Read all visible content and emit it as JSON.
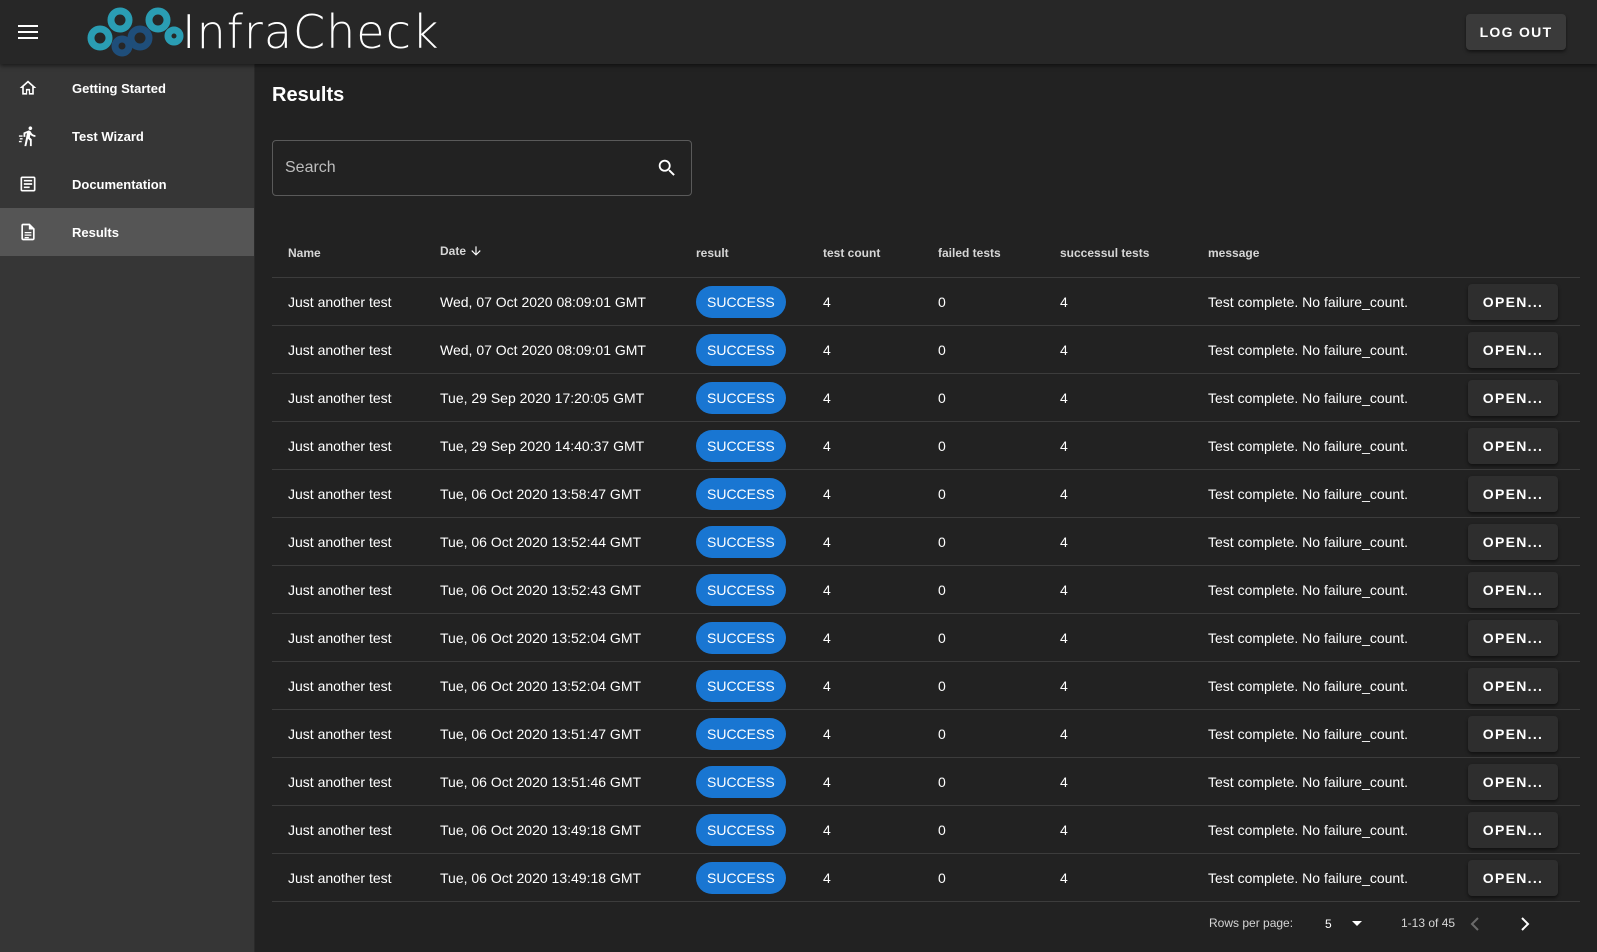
{
  "app": {
    "logo_text": "InfraCheck",
    "logout_label": "LOG OUT"
  },
  "sidebar": {
    "items": [
      {
        "label": "Getting Started",
        "icon": "home-icon",
        "active": false
      },
      {
        "label": "Test Wizard",
        "icon": "running-icon",
        "active": false
      },
      {
        "label": "Documentation",
        "icon": "article-icon",
        "active": false
      },
      {
        "label": "Results",
        "icon": "document-icon",
        "active": true
      }
    ]
  },
  "main": {
    "title": "Results",
    "search": {
      "placeholder": "Search",
      "value": ""
    }
  },
  "table": {
    "columns": [
      "Name",
      "Date",
      "result",
      "test count",
      "failed tests",
      "successul tests",
      "message"
    ],
    "sort_column": "Date",
    "sort_direction": "desc",
    "action_label": "OPEN...",
    "rows": [
      {
        "name": "Just another test",
        "date": "Wed, 07 Oct 2020 08:09:01 GMT",
        "result": "SUCCESS",
        "test_count": "4",
        "failed": "0",
        "successful": "4",
        "message": "Test complete. No failure_count."
      },
      {
        "name": "Just another test",
        "date": "Wed, 07 Oct 2020 08:09:01 GMT",
        "result": "SUCCESS",
        "test_count": "4",
        "failed": "0",
        "successful": "4",
        "message": "Test complete. No failure_count."
      },
      {
        "name": "Just another test",
        "date": "Tue, 29 Sep 2020 17:20:05 GMT",
        "result": "SUCCESS",
        "test_count": "4",
        "failed": "0",
        "successful": "4",
        "message": "Test complete. No failure_count."
      },
      {
        "name": "Just another test",
        "date": "Tue, 29 Sep 2020 14:40:37 GMT",
        "result": "SUCCESS",
        "test_count": "4",
        "failed": "0",
        "successful": "4",
        "message": "Test complete. No failure_count."
      },
      {
        "name": "Just another test",
        "date": "Tue, 06 Oct 2020 13:58:47 GMT",
        "result": "SUCCESS",
        "test_count": "4",
        "failed": "0",
        "successful": "4",
        "message": "Test complete. No failure_count."
      },
      {
        "name": "Just another test",
        "date": "Tue, 06 Oct 2020 13:52:44 GMT",
        "result": "SUCCESS",
        "test_count": "4",
        "failed": "0",
        "successful": "4",
        "message": "Test complete. No failure_count."
      },
      {
        "name": "Just another test",
        "date": "Tue, 06 Oct 2020 13:52:43 GMT",
        "result": "SUCCESS",
        "test_count": "4",
        "failed": "0",
        "successful": "4",
        "message": "Test complete. No failure_count."
      },
      {
        "name": "Just another test",
        "date": "Tue, 06 Oct 2020 13:52:04 GMT",
        "result": "SUCCESS",
        "test_count": "4",
        "failed": "0",
        "successful": "4",
        "message": "Test complete. No failure_count."
      },
      {
        "name": "Just another test",
        "date": "Tue, 06 Oct 2020 13:52:04 GMT",
        "result": "SUCCESS",
        "test_count": "4",
        "failed": "0",
        "successful": "4",
        "message": "Test complete. No failure_count."
      },
      {
        "name": "Just another test",
        "date": "Tue, 06 Oct 2020 13:51:47 GMT",
        "result": "SUCCESS",
        "test_count": "4",
        "failed": "0",
        "successful": "4",
        "message": "Test complete. No failure_count."
      },
      {
        "name": "Just another test",
        "date": "Tue, 06 Oct 2020 13:51:46 GMT",
        "result": "SUCCESS",
        "test_count": "4",
        "failed": "0",
        "successful": "4",
        "message": "Test complete. No failure_count."
      },
      {
        "name": "Just another test",
        "date": "Tue, 06 Oct 2020 13:49:18 GMT",
        "result": "SUCCESS",
        "test_count": "4",
        "failed": "0",
        "successful": "4",
        "message": "Test complete. No failure_count."
      },
      {
        "name": "Just another test",
        "date": "Tue, 06 Oct 2020 13:49:18 GMT",
        "result": "SUCCESS",
        "test_count": "4",
        "failed": "0",
        "successful": "4",
        "message": "Test complete. No failure_count."
      }
    ]
  },
  "pagination": {
    "rows_per_page_label": "Rows per page:",
    "rows_per_page": "5",
    "range": "1-13 of 45"
  },
  "colors": {
    "background": "#222222",
    "appbar": "#272727",
    "sidebar": "#363636",
    "sidebar_active": "#555555",
    "chip": "#1976d2",
    "logo_teal": "#2a9db3",
    "logo_navy": "#1f4e7a"
  }
}
